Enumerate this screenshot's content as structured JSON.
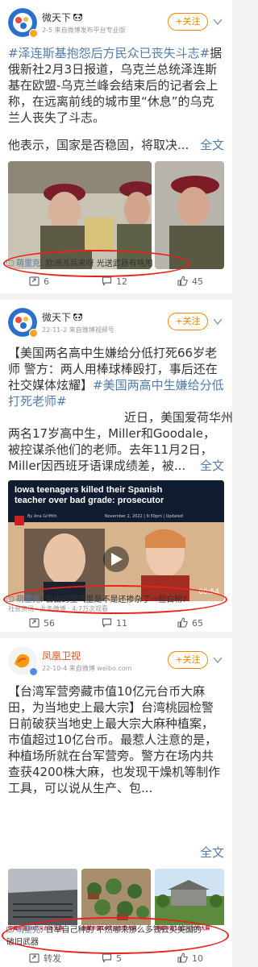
{
  "feed": {
    "posts": [
      {
        "author": "微天下",
        "meta": "2-5  来自微博发布平台专业版",
        "follow_label": "+关注",
        "hashtag": "#泽连斯基抱怨后方民众已丧失斗志#",
        "text": "据俄新社2月3日报道，乌克兰总统泽连斯基在欧盟-乌克兰峰会结束后的记者会上称，在远离前线的城市里“休息”的乌克兰人丧失了斗志。",
        "text2": "他表示，国家是否稳固，将取决...",
        "expand_label": "全文",
        "comment": {
          "user": "萌里克",
          "text": "欧洲派兵来呀 光送武器有啥用"
        },
        "actions": {
          "reposts": "6",
          "comments": "12",
          "likes": "45"
        }
      },
      {
        "author": "微天下",
        "meta": "22-11-2  来自微博视频号",
        "follow_label": "+关注",
        "hashtag_prefix": "【美国两名高中生嫌给分低打死66岁老师 警方：两人用棒球棒殴打，事后还在社交媒体炫耀】",
        "hashtag": "#美国两高中生嫌给分低打死老师#",
        "text_lines": [
          "近日，美国爱荷华州",
          "两名17岁高中生，Miller和Goodale，",
          "被控谋杀他们的老师。去年11月2日，",
          "Miller因西班牙语课成绩差，被..."
        ],
        "expand_label": "全文",
        "video": {
          "headline": "Iowa teenagers killed their Spanish teacher over bad grade: prosecutor",
          "byline": "By Ana Griffith",
          "date": "November 2, 2022 | 9:30pm | Updated",
          "duration": "00:54"
        },
        "subinfo": "社会资讯 · 此条微博 · 4.7万次观看",
        "comment": {
          "user": "萌里克",
          "text": "自由的空气里是不是还掺杂了一些白粉?"
        },
        "actions": {
          "reposts": "56",
          "comments": "11",
          "likes": "65"
        }
      },
      {
        "author": "凤凰卫视",
        "meta": "22-10-4  来自微博 weibo.com",
        "follow_label": "+关注",
        "headline": "【台湾军营旁藏市值10亿元台币大麻田，为当地史上最大宗】",
        "text": "台湾桃园检警日前破获当地史上最大宗大麻种植案，市值超过10亿台币。最惹人注意的是，种植场所就在台军营旁。警方在场内共查获4200株大麻，也发现干燥机等制作工具，可以说从生产、包...",
        "expand_label": "全文",
        "images": [
          {
            "caption": "旁藏市值10亿元台币大麻"
          },
          {
            "caption": "旁藏市值10亿元台币大麻"
          },
          {
            "caption": "旁藏市值10亿元台币大麻"
          }
        ],
        "comment": {
          "user": "萌里克",
          "text": "台军自己种的 不然哪来那么多钱去买美国的",
          "text2": "破旧武器"
        },
        "actions": {
          "reposts": "转发",
          "comments": "5",
          "likes": "10"
        }
      }
    ]
  },
  "colors": {
    "accent": "#ff8200",
    "link": "#507daf",
    "annotation": "#e8211a"
  }
}
